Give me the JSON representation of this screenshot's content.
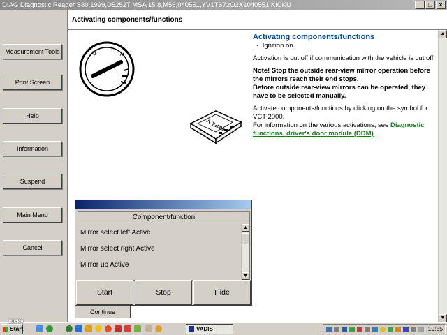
{
  "window": {
    "title": "DIAG Diagnostic Reader S80,1999,D5252T MSA 15.8,M56,040551,YV1TS72Q2X1040551 KICKU",
    "min": "_",
    "max": "□",
    "close": "✕"
  },
  "sidebar": {
    "items": [
      {
        "label": "Measurement Tools"
      },
      {
        "label": "Print Screen"
      },
      {
        "label": "Help"
      },
      {
        "label": "Information"
      },
      {
        "label": "Suspend"
      },
      {
        "label": "Main Menu"
      },
      {
        "label": "Cancel"
      }
    ]
  },
  "main": {
    "header": "Activating components/functions",
    "vct_label": "VCT2000",
    "text": {
      "title": "Activating components/functions",
      "bullet": "Ignition on.",
      "p1": "Activation is cut off if communication with the vehicle is cut off.",
      "p2_l1": "Note! Stop the outside rear-view mirror operation before the mirrors reach their end stops.",
      "p2_l2": "Before outside rear-view mirrors can be operated, they have to be selected manually.",
      "p3": "Activate components/functions by clicking on the symbol for VCT 2000.",
      "p4_prefix": "For information on the various activations, see",
      "p4_link": "Diagnostic functions, driver's door module (DDM)",
      "p4_suffix": "."
    }
  },
  "dialog": {
    "header": "Component/function",
    "items": [
      "Mirror select left Active",
      "Mirror select right Active",
      "Mirror up Active"
    ],
    "buttons": {
      "start": "Start",
      "stop": "Stop",
      "hide": "Hide"
    }
  },
  "continue_label": "Continue",
  "taskbar": {
    "start": "Start",
    "task": "VADIS",
    "clock": "19:55"
  },
  "watermark": "bicky"
}
